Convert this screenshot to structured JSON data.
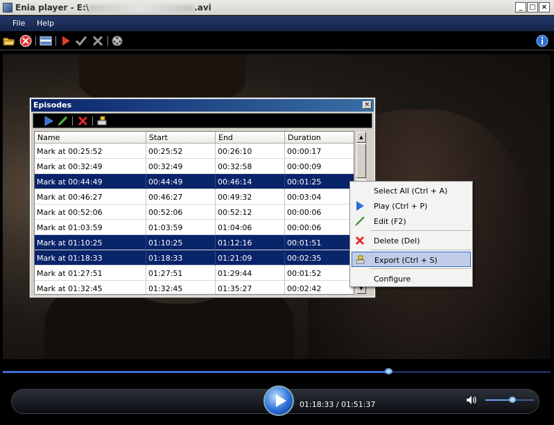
{
  "window": {
    "title_prefix": "Enia player - E:\\",
    "title_suffix": ".avi",
    "minimize": "_",
    "maximize": "□",
    "close": "×"
  },
  "menu": {
    "file": "File",
    "help": "Help"
  },
  "toolbar_icons": [
    "open-folder-icon",
    "stop-icon",
    "panel-icon",
    "play-icon",
    "check-icon",
    "cancel-icon",
    "film-reel-icon",
    "info-icon"
  ],
  "episodes": {
    "title": "Episodes",
    "close": "×",
    "columns": [
      "Name",
      "Start",
      "End",
      "Duration"
    ],
    "rows": [
      {
        "name": "Mark at 00:25:52",
        "start": "00:25:52",
        "end": "00:26:10",
        "duration": "00:00:17",
        "selected": false
      },
      {
        "name": "Mark at 00:32:49",
        "start": "00:32:49",
        "end": "00:32:58",
        "duration": "00:00:09",
        "selected": false
      },
      {
        "name": "Mark at 00:44:49",
        "start": "00:44:49",
        "end": "00:46:14",
        "duration": "00:01:25",
        "selected": true
      },
      {
        "name": "Mark at 00:46:27",
        "start": "00:46:27",
        "end": "00:49:32",
        "duration": "00:03:04",
        "selected": false
      },
      {
        "name": "Mark at 00:52:06",
        "start": "00:52:06",
        "end": "00:52:12",
        "duration": "00:00:06",
        "selected": false
      },
      {
        "name": "Mark at 01:03:59",
        "start": "01:03:59",
        "end": "01:04:06",
        "duration": "00:00:06",
        "selected": false
      },
      {
        "name": "Mark at 01:10:25",
        "start": "01:10:25",
        "end": "01:12:16",
        "duration": "00:01:51",
        "selected": true
      },
      {
        "name": "Mark at 01:18:33",
        "start": "01:18:33",
        "end": "01:21:09",
        "duration": "00:02:35",
        "selected": true
      },
      {
        "name": "Mark at 01:27:51",
        "start": "01:27:51",
        "end": "01:29:44",
        "duration": "00:01:52",
        "selected": false
      },
      {
        "name": "Mark at 01:32:45",
        "start": "01:32:45",
        "end": "01:35:27",
        "duration": "00:02:42",
        "selected": false
      }
    ]
  },
  "context_menu": {
    "select_all": "Select All (Ctrl + A)",
    "play": "Play (Ctrl + P)",
    "edit": "Edit (F2)",
    "delete": "Delete (Del)",
    "export": "Export (Ctrl + S)",
    "configure": "Configure",
    "highlighted": "export"
  },
  "player": {
    "time": "01:18:33 / 01:51:37",
    "progress": 0.7038,
    "volume": 0.55,
    "accent": "#3f6cd9"
  }
}
